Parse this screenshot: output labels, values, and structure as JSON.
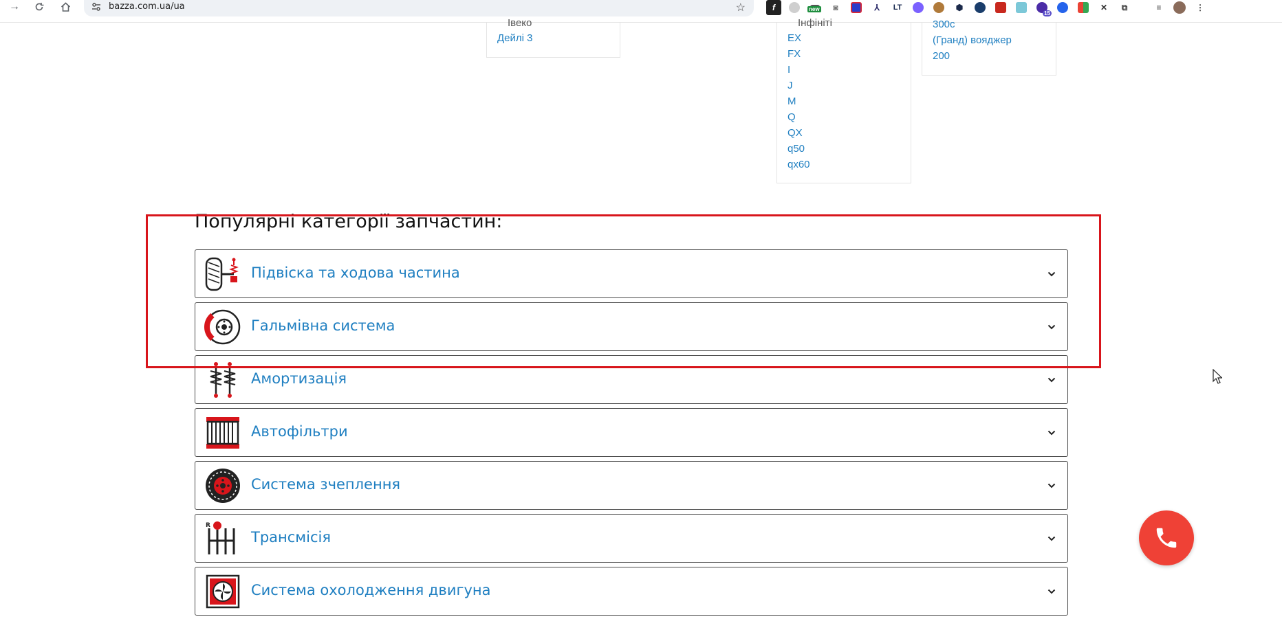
{
  "browser": {
    "url": "bazza.com.ua/ua",
    "ext_new_badge": "new",
    "ext_badge_count": "15"
  },
  "brand_models": {
    "iveco": {
      "brand": "Івеко",
      "models": [
        "Дейлі 3"
      ]
    },
    "infiniti": {
      "brand": "Інфініті",
      "models": [
        "EX",
        "FX",
        "I",
        "J",
        "M",
        "Q",
        "QX",
        "q50",
        "qx60"
      ]
    },
    "chrysler": {
      "models": [
        "300c",
        "(Гранд) вояджер",
        "200"
      ]
    }
  },
  "categories": {
    "title": "Популярні категорії запчастин:",
    "items": [
      {
        "label": "Підвіска та ходова частина",
        "icon": "suspension-icon"
      },
      {
        "label": "Гальмівна система",
        "icon": "brake-disc-icon"
      },
      {
        "label": "Амортизація",
        "icon": "shock-absorber-icon"
      },
      {
        "label": "Автофільтри",
        "icon": "filter-icon"
      },
      {
        "label": "Система зчеплення",
        "icon": "clutch-icon"
      },
      {
        "label": "Трансмісія",
        "icon": "gearshift-icon"
      },
      {
        "label": "Система охолодження двигуна",
        "icon": "radiator-icon"
      }
    ]
  },
  "colors": {
    "link": "#1f7fc1",
    "accent_red": "#d8151b",
    "phone_button": "#ef4136"
  }
}
